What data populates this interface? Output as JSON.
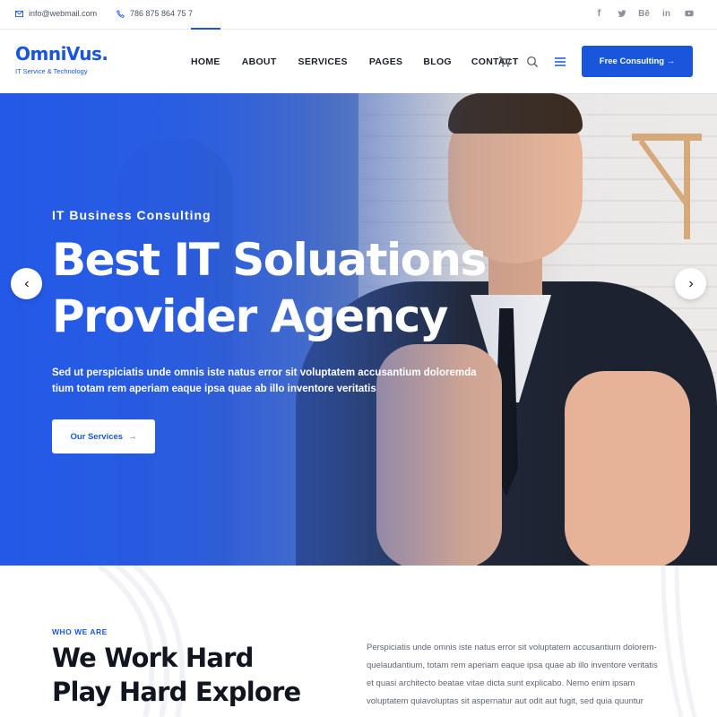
{
  "topbar": {
    "email": "info@webmail.com",
    "phone": "786 875 864 75 7",
    "socials": [
      "f",
      "twitter",
      "Bē",
      "in",
      "youtube"
    ]
  },
  "header": {
    "logo_name": "OmniVus.",
    "logo_tagline": "IT Service & Technology",
    "nav": [
      {
        "label": "HOME",
        "active": true
      },
      {
        "label": "ABOUT"
      },
      {
        "label": "SERVICES"
      },
      {
        "label": "PAGES"
      },
      {
        "label": "BLOG"
      },
      {
        "label": "CONTACT"
      }
    ],
    "cta_label": "Free Consulting →",
    "accent": "#1a56db"
  },
  "hero": {
    "eyebrow": "IT Business Consulting",
    "title_line1": "Best IT Soluations",
    "title_line2": "Provider Agency",
    "description": "Sed ut perspiciatis unde omnis iste natus error sit voluptatem accusantium doloremda tium totam rem aperiam eaque ipsa quae ab illo inventore veritatis",
    "button_label": "Our Services",
    "prev_icon": "chevron-left-icon",
    "next_icon": "chevron-right-icon"
  },
  "about": {
    "eyebrow": "WHO WE ARE",
    "title_line1": "We Work Hard",
    "title_line2": "Play Hard Explore",
    "text": "Perspiciatis unde omnis iste natus error sit voluptatem accusantium dolorem-quelaudantium, totam rem aperiam eaque ipsa quae ab illo inventore veritatis et quasi architecto beatae vitae dicta sunt explicabo. Nemo enim ipsam voluptatem quiavoluptas sit aspernatur aut odit aut fugit, sed quia quuntur"
  }
}
